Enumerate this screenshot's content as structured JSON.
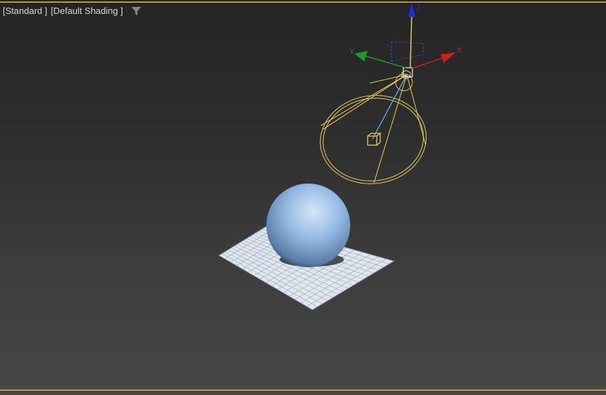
{
  "viewport": {
    "labels": [
      {
        "text": "[Standard ]"
      },
      {
        "text": "[Default Shading ]"
      }
    ],
    "filter_icon": "funnel-icon",
    "colors": {
      "frame": "#b89c3c",
      "light_wire": "#d9c35a",
      "sphere": "#8fb4e0",
      "plane": "#dce4ee",
      "axis_x": "#cc1f1f",
      "axis_y": "#1c9a2a",
      "axis_z": "#1f2bd6"
    }
  },
  "gizmo": {
    "x_label": "X",
    "y_label": "Y",
    "z_label": "Z"
  }
}
